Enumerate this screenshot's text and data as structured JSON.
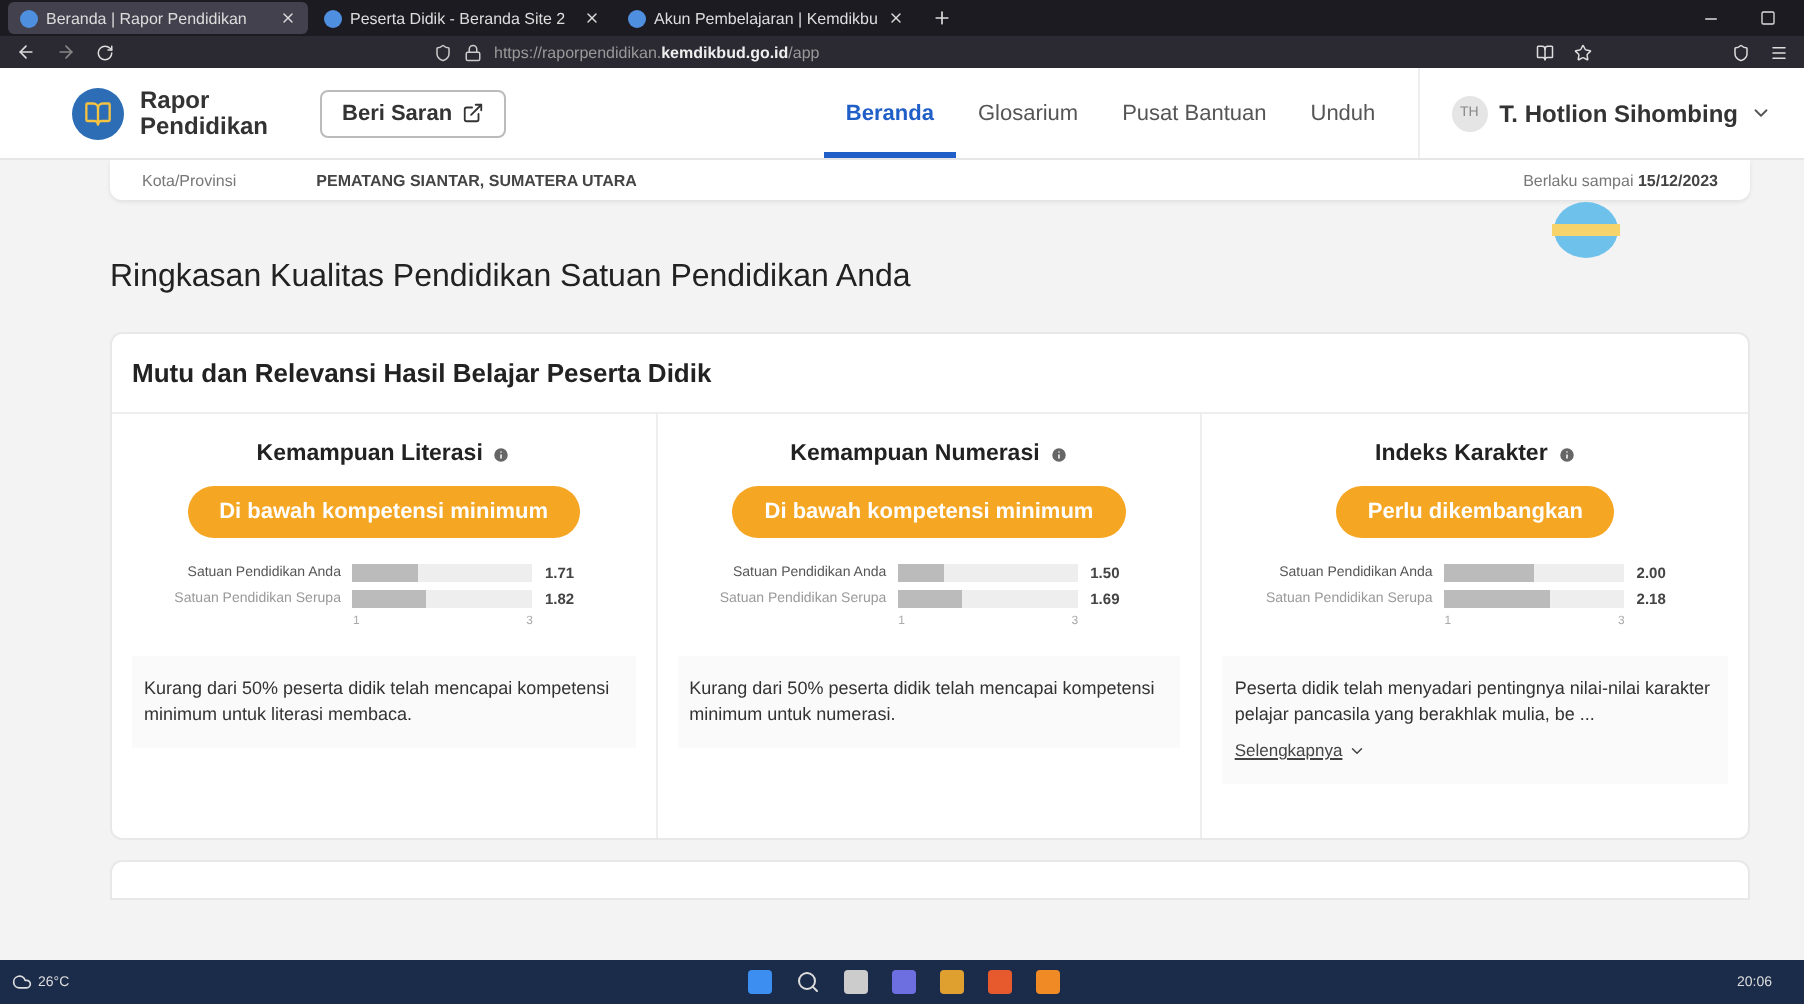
{
  "browser": {
    "tabs": [
      {
        "title": "Beranda | Rapor Pendidikan",
        "selected": true
      },
      {
        "title": "Peserta Didik - Beranda Site 2",
        "selected": false
      },
      {
        "title": "Akun Pembelajaran | Kemdikbu",
        "selected": false
      }
    ],
    "url_prefix": "https://raporpendidikan.",
    "url_domain": "kemdikbud.go.id",
    "url_path": "/app"
  },
  "header": {
    "logo_line1": "Rapor",
    "logo_line2": "Pendidikan",
    "feedback_button": "Beri Saran",
    "nav": [
      {
        "label": "Beranda",
        "selected": true
      },
      {
        "label": "Glosarium",
        "selected": false
      },
      {
        "label": "Pusat Bantuan",
        "selected": false
      },
      {
        "label": "Unduh",
        "selected": false
      }
    ],
    "user_initials": "TH",
    "user_name": "T. Hotlion Sihombing"
  },
  "school_card": {
    "field_label": "Kota/Provinsi",
    "field_value": "PEMATANG SIANTAR, SUMATERA UTARA",
    "validity_label": "Berlaku sampai",
    "validity_date": "15/12/2023"
  },
  "section_title": "Ringkasan Kualitas Pendidikan Satuan Pendidikan Anda",
  "panel": {
    "title": "Mutu dan Relevansi Hasil Belajar Peserta Didik",
    "metrics": [
      {
        "title": "Kemampuan Literasi",
        "status": "Di bawah kompetensi minimum",
        "rows": [
          {
            "label": "Satuan Pendidikan Anda",
            "level": 0.36,
            "value": "1.71"
          },
          {
            "label": "Satuan Pendidikan Serupa",
            "level": 0.41,
            "value": "1.82"
          }
        ],
        "scale_min": "1",
        "scale_max": "3",
        "description": "Kurang dari 50% peserta didik telah mencapai kompetensi minimum untuk literasi membaca."
      },
      {
        "title": "Kemampuan Numerasi",
        "status": "Di bawah kompetensi minimum",
        "rows": [
          {
            "label": "Satuan Pendidikan Anda",
            "level": 0.25,
            "value": "1.50"
          },
          {
            "label": "Satuan Pendidikan Serupa",
            "level": 0.35,
            "value": "1.69"
          }
        ],
        "scale_min": "1",
        "scale_max": "3",
        "description": "Kurang dari 50% peserta didik telah mencapai kompetensi minimum untuk numerasi."
      },
      {
        "title": "Indeks Karakter",
        "status": "Perlu dikembangkan",
        "rows": [
          {
            "label": "Satuan Pendidikan Anda",
            "level": 0.5,
            "value": "2.00"
          },
          {
            "label": "Satuan Pendidikan Serupa",
            "level": 0.59,
            "value": "2.18"
          }
        ],
        "scale_min": "1",
        "scale_max": "3",
        "description": "Peserta didik telah menyadari pentingnya nilai-nilai karakter pelajar pancasila yang berakhlak mulia, be ...",
        "more_link": "Selengkapnya"
      }
    ]
  },
  "taskbar": {
    "temperature": "26°C",
    "time": "20:06"
  }
}
